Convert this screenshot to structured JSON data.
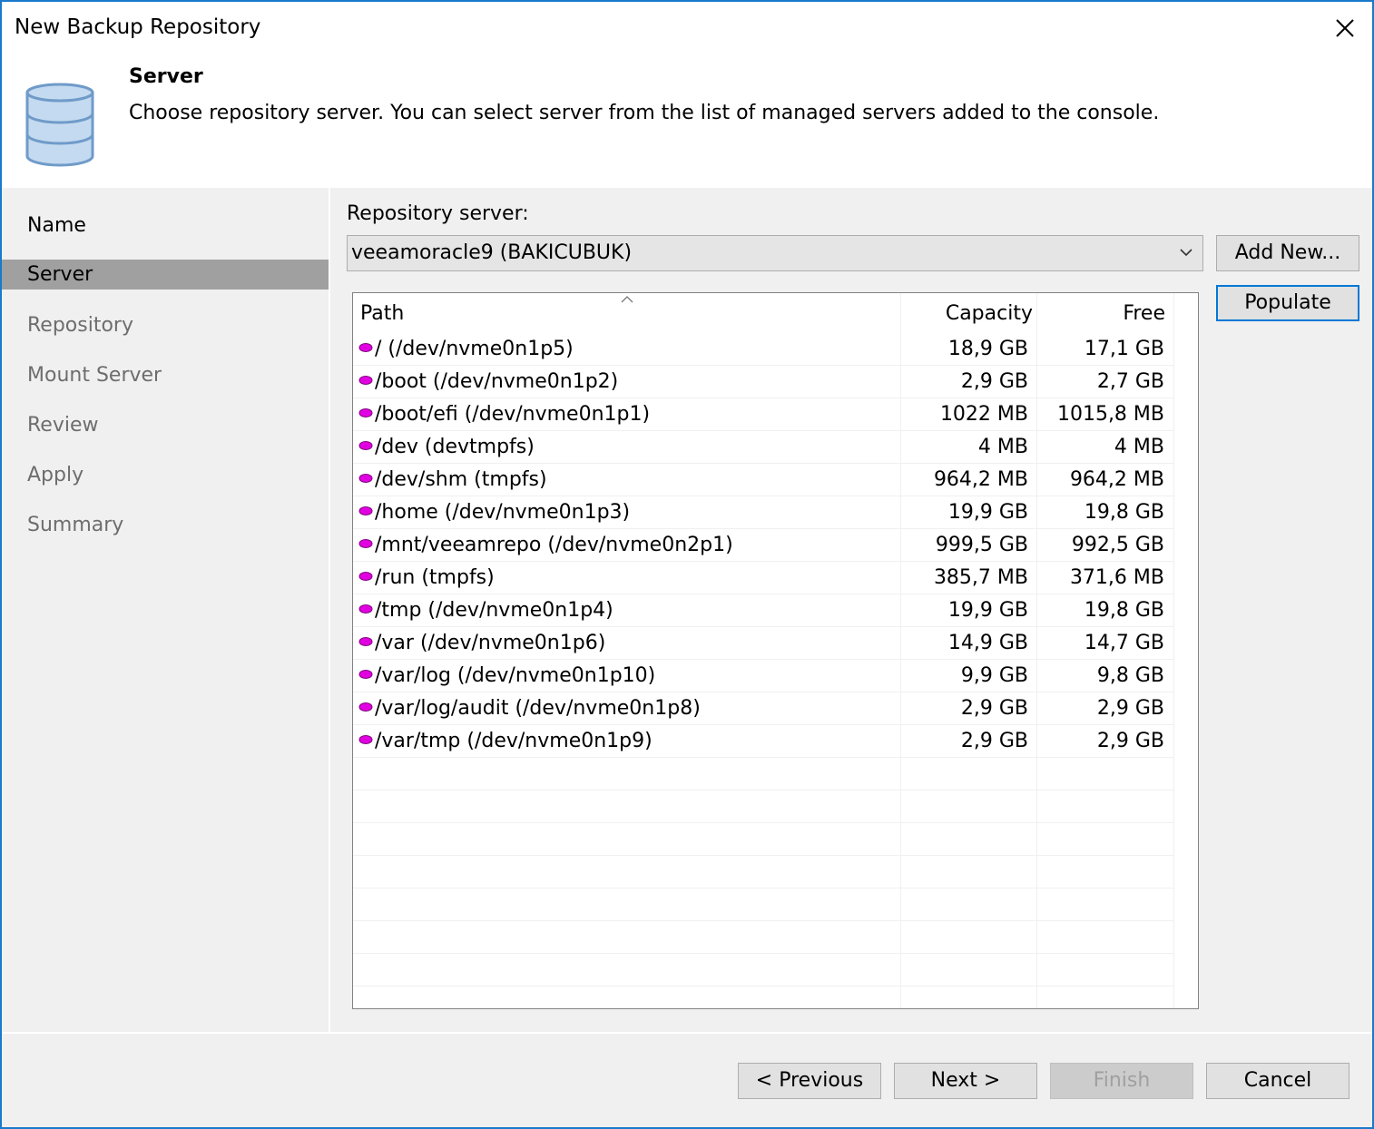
{
  "window": {
    "title": "New Backup Repository"
  },
  "header": {
    "title": "Server",
    "description": "Choose repository server. You can select server from the list of managed servers added to the console."
  },
  "sidebar": {
    "items": [
      {
        "label": "Name",
        "state": "done"
      },
      {
        "label": "Server",
        "state": "active"
      },
      {
        "label": "Repository",
        "state": "pending"
      },
      {
        "label": "Mount Server",
        "state": "pending"
      },
      {
        "label": "Review",
        "state": "pending"
      },
      {
        "label": "Apply",
        "state": "pending"
      },
      {
        "label": "Summary",
        "state": "pending"
      }
    ]
  },
  "main": {
    "repo_label": "Repository server:",
    "repo_value": "veeamoracle9 (BAKICUBUK)",
    "add_new_label": "Add New...",
    "populate_label": "Populate",
    "table": {
      "columns": [
        "Path",
        "Capacity",
        "Free"
      ],
      "rows": [
        {
          "path": "/ (/dev/nvme0n1p5)",
          "capacity": "18,9 GB",
          "free": "17,1 GB"
        },
        {
          "path": "/boot (/dev/nvme0n1p2)",
          "capacity": "2,9 GB",
          "free": "2,7 GB"
        },
        {
          "path": "/boot/efi (/dev/nvme0n1p1)",
          "capacity": "1022 MB",
          "free": "1015,8 MB"
        },
        {
          "path": "/dev (devtmpfs)",
          "capacity": "4 MB",
          "free": "4 MB"
        },
        {
          "path": "/dev/shm (tmpfs)",
          "capacity": "964,2 MB",
          "free": "964,2 MB"
        },
        {
          "path": "/home (/dev/nvme0n1p3)",
          "capacity": "19,9 GB",
          "free": "19,8 GB"
        },
        {
          "path": "/mnt/veeamrepo (/dev/nvme0n2p1)",
          "capacity": "999,5 GB",
          "free": "992,5 GB"
        },
        {
          "path": "/run (tmpfs)",
          "capacity": "385,7 MB",
          "free": "371,6 MB"
        },
        {
          "path": "/tmp (/dev/nvme0n1p4)",
          "capacity": "19,9 GB",
          "free": "19,8 GB"
        },
        {
          "path": "/var (/dev/nvme0n1p6)",
          "capacity": "14,9 GB",
          "free": "14,7 GB"
        },
        {
          "path": "/var/log (/dev/nvme0n1p10)",
          "capacity": "9,9 GB",
          "free": "9,8 GB"
        },
        {
          "path": "/var/log/audit (/dev/nvme0n1p8)",
          "capacity": "2,9 GB",
          "free": "2,9 GB"
        },
        {
          "path": "/var/tmp (/dev/nvme0n1p9)",
          "capacity": "2,9 GB",
          "free": "2,9 GB"
        }
      ]
    }
  },
  "footer": {
    "previous_label": "< Previous",
    "next_label": "Next >",
    "finish_label": "Finish",
    "cancel_label": "Cancel"
  },
  "icons": {
    "header": "database-icon",
    "disk": "disk-icon",
    "close": "close-icon",
    "dropdown": "chevron-down-icon"
  },
  "colors": {
    "window_border": "#1979ca",
    "sidebar_active": "#a0a0a0",
    "disk_icon": "#e000e0",
    "focus_border": "#0078d7"
  }
}
